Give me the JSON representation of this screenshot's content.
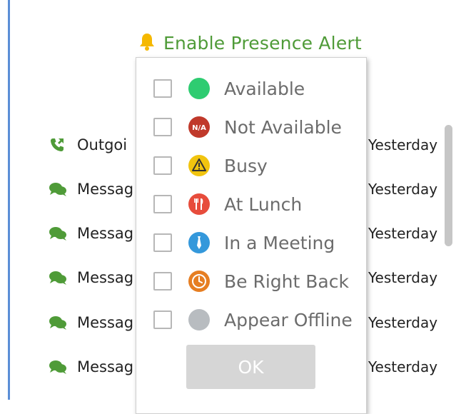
{
  "header": {
    "alert_label": "Enable Presence Alert",
    "icon": "bell-icon"
  },
  "history": [
    {
      "icon": "outgoing-call-icon",
      "label": "Outgoi",
      "time": "Yesterday"
    },
    {
      "icon": "chat-bubbles-icon",
      "label": "Messag",
      "time": "Yesterday"
    },
    {
      "icon": "chat-bubbles-icon",
      "label": "Messag",
      "time": "Yesterday"
    },
    {
      "icon": "chat-bubbles-icon",
      "label": "Messag",
      "time": "Yesterday"
    },
    {
      "icon": "chat-bubbles-icon",
      "label": "Messag",
      "time": "Yesterday"
    },
    {
      "icon": "chat-bubbles-icon",
      "label": "Messag",
      "time": "Yesterday"
    }
  ],
  "presence_options": [
    {
      "label": "Available",
      "checked": false,
      "icon": "available-icon",
      "color": "#2ecc71"
    },
    {
      "label": "Not Available",
      "checked": false,
      "icon": "not-available-icon",
      "color": "#c0392b",
      "badge": "N/A"
    },
    {
      "label": "Busy",
      "checked": false,
      "icon": "busy-warning-icon",
      "color": "#f1c40f"
    },
    {
      "label": "At Lunch",
      "checked": false,
      "icon": "lunch-utensils-icon",
      "color": "#e74c3c"
    },
    {
      "label": "In a Meeting",
      "checked": false,
      "icon": "meeting-tie-icon",
      "color": "#3498db"
    },
    {
      "label": "Be Right Back",
      "checked": false,
      "icon": "clock-icon",
      "color": "#e67e22"
    },
    {
      "label": "Appear Offline",
      "checked": false,
      "icon": "offline-icon",
      "color": "#b8bcc0"
    }
  ],
  "ok_button": {
    "label": "OK"
  },
  "colors": {
    "accent_green": "#4f9b38",
    "left_border": "#5b8ed6",
    "bell": "#f5b800",
    "history_icon": "#4f9b38"
  }
}
